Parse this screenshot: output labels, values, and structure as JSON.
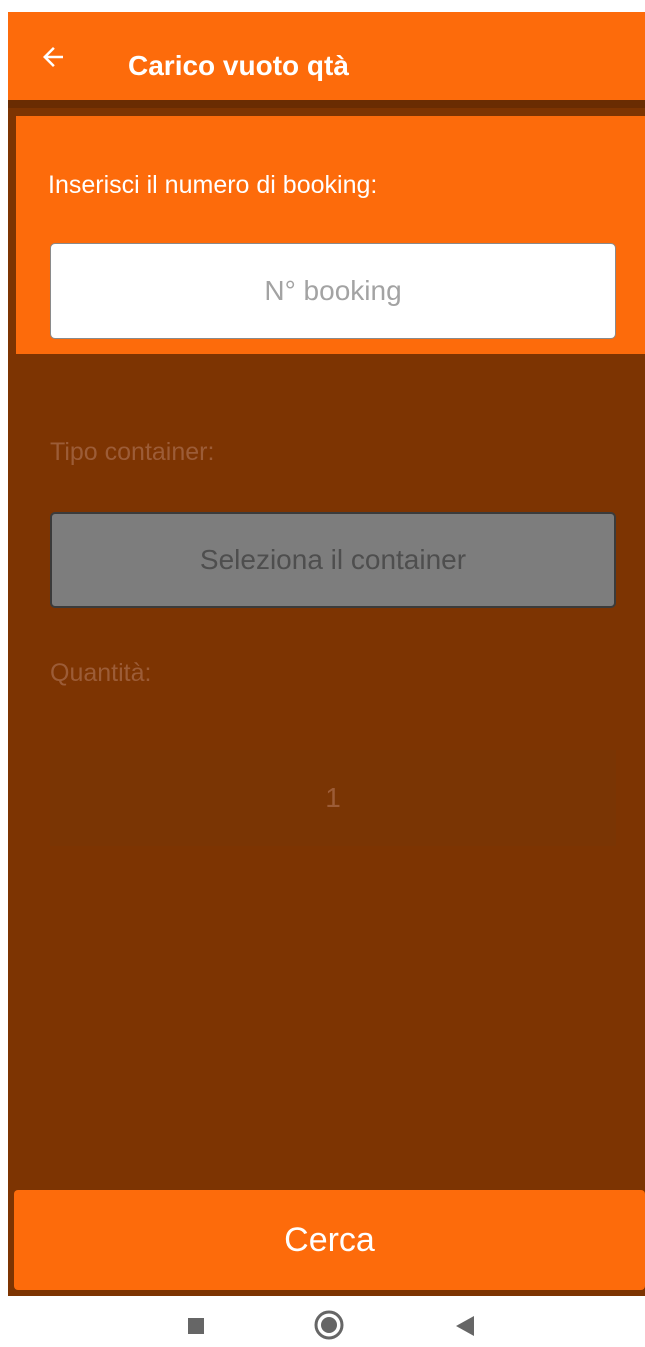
{
  "appbar": {
    "title": "Carico vuoto qtà",
    "back_icon": "arrow-left-icon"
  },
  "booking": {
    "label": "Inserisci il numero di booking:",
    "placeholder": "N° booking",
    "value": ""
  },
  "container": {
    "label": "Tipo container:",
    "selected": "Seleziona il container"
  },
  "quantity": {
    "label": "Quantità:",
    "value": "1"
  },
  "actions": {
    "search_label": "Cerca"
  },
  "navbar": {
    "icons": [
      "recent-apps-icon",
      "home-icon",
      "back-icon"
    ]
  },
  "colors": {
    "primary": "#fd6b0b",
    "background_dim": "#7d3402",
    "disabled_select": "#7d7d7d"
  }
}
